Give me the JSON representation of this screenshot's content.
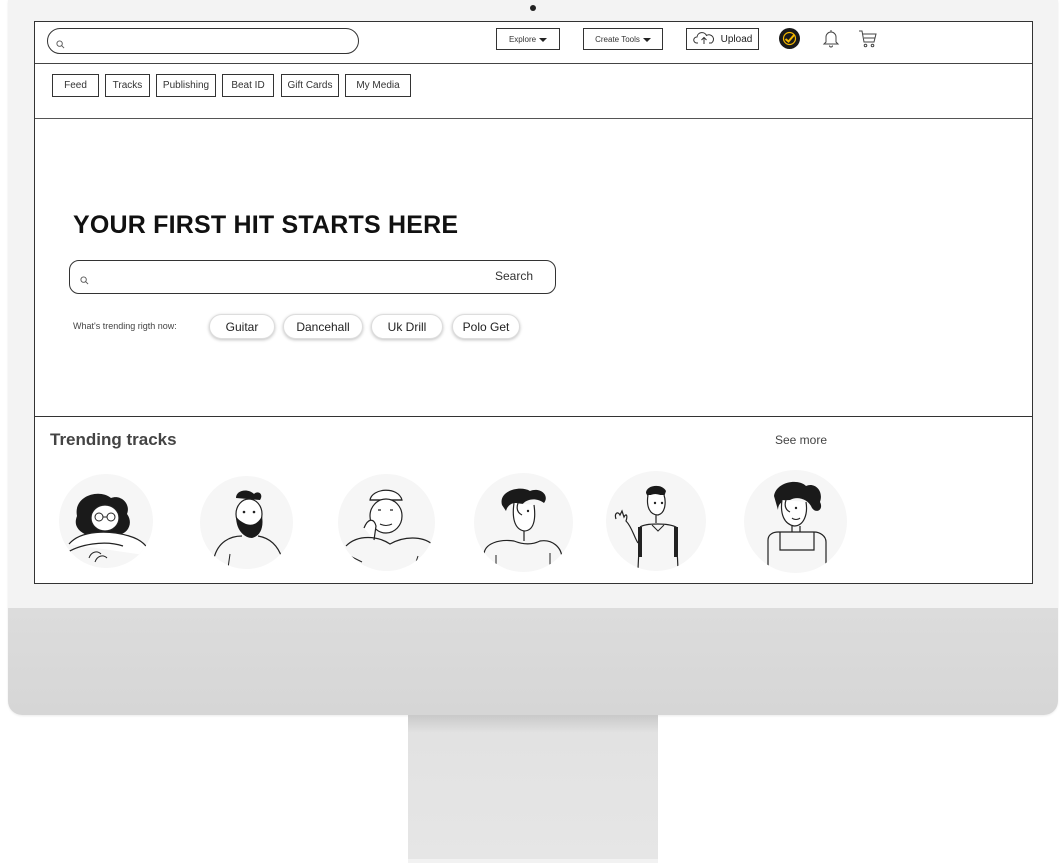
{
  "header": {
    "search_placeholder": "",
    "explore_label": "Explore",
    "create_tools_label": "Create Tools",
    "upload_label": "Upload"
  },
  "nav": {
    "tabs": [
      "Feed",
      "Tracks",
      "Publishing",
      "Beat ID",
      "Gift Cards",
      "My Media"
    ]
  },
  "hero": {
    "title": "YOUR FIRST HIT STARTS HERE",
    "search_placeholder": "",
    "search_button": "Search",
    "trending_label": "What's trending rigth now:",
    "chips": [
      "Guitar",
      "Dancehall",
      "Uk Drill",
      "Polo Get"
    ]
  },
  "trending_tracks": {
    "title": "Trending tracks",
    "see_more": "See more"
  },
  "colors": {
    "border": "#333333",
    "brand_icon_bg": "#1a1a1a",
    "brand_icon_accent": "#f5b800",
    "bezel": "#f3f3f3",
    "chin": "#d8d8d8"
  },
  "icons": [
    "search-icon",
    "caret-down-icon",
    "cloud-upload-icon",
    "brand-check-icon",
    "bell-icon",
    "cart-icon"
  ]
}
